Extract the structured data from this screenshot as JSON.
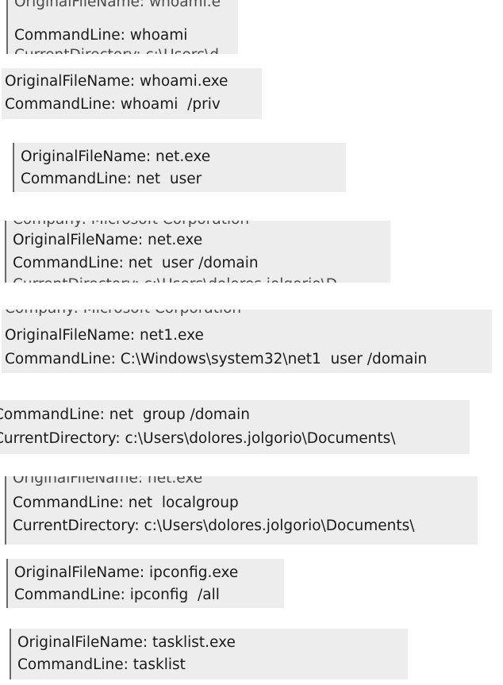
{
  "snippets": [
    {
      "lines": [
        {
          "text": "OriginalFileName: whoami.e",
          "partial": true
        },
        {
          "text": "CommandLine: whoami",
          "partial": false
        },
        {
          "text": "CurrentDirectory: c:\\Users\\d",
          "partial": true
        }
      ]
    },
    {
      "lines": [
        {
          "text": "OriginalFileName: whoami.exe",
          "partial": false
        },
        {
          "text": "CommandLine: whoami  /priv",
          "partial": false
        }
      ]
    },
    {
      "lines": [
        {
          "text": "OriginalFileName: net.exe",
          "partial": false
        },
        {
          "text": "CommandLine: net  user",
          "partial": false
        }
      ]
    },
    {
      "lines": [
        {
          "text": "Company: Microsoft Corporation",
          "partial": true
        },
        {
          "text": "OriginalFileName: net.exe",
          "partial": false
        },
        {
          "text": "CommandLine: net  user /domain",
          "partial": false
        },
        {
          "text": "CurrentDirectory: c:\\Users\\dolores.jolgorio\\D",
          "partial": true
        }
      ]
    },
    {
      "lines": [
        {
          "text": "Company: Microsoft Corporation",
          "partial": true
        },
        {
          "text": "OriginalFileName: net1.exe",
          "partial": false
        },
        {
          "text": "CommandLine: C:\\Windows\\system32\\net1  user /domain",
          "partial": false
        }
      ]
    },
    {
      "lines": [
        {
          "text": "CommandLine: net  group /domain",
          "partial": false
        },
        {
          "text": "CurrentDirectory: c:\\Users\\dolores.jolgorio\\Documents\\",
          "partial": false
        }
      ]
    },
    {
      "lines": [
        {
          "text": "OriginalFileName: net.exe",
          "partial": true
        },
        {
          "text": "CommandLine: net  localgroup",
          "partial": false
        },
        {
          "text": "CurrentDirectory: c:\\Users\\dolores.jolgorio\\Documents\\",
          "partial": false
        }
      ]
    },
    {
      "lines": [
        {
          "text": "OriginalFileName: ipconfig.exe",
          "partial": false
        },
        {
          "text": "CommandLine: ipconfig  /all",
          "partial": false
        }
      ]
    },
    {
      "lines": [
        {
          "text": "OriginalFileName: tasklist.exe",
          "partial": false
        },
        {
          "text": "CommandLine: tasklist",
          "partial": false
        }
      ]
    }
  ]
}
